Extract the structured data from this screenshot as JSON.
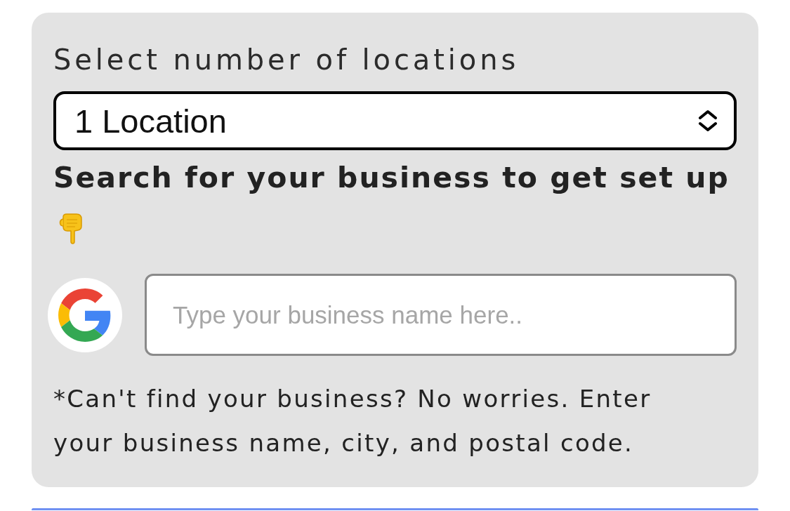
{
  "form": {
    "locations_label": "Select number of locations",
    "locations_select": {
      "value": "1 Location"
    },
    "search_heading": "Search for your business to get set up",
    "business_search": {
      "placeholder": "Type your business name here.."
    },
    "note": "*Can't find your business? No worries. Enter your business name, city, and postal code."
  }
}
